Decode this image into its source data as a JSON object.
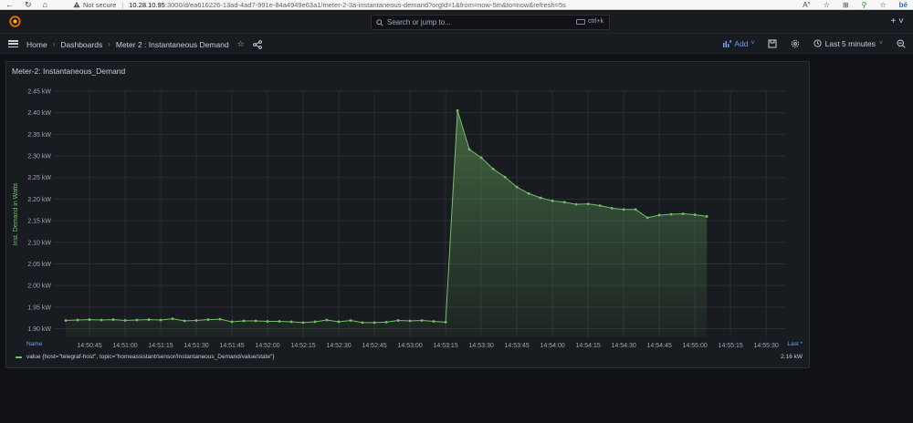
{
  "browser": {
    "nav_glyphs": [
      "←",
      "↻",
      "⌂"
    ],
    "security_label": "Not secure",
    "url_host": "10.28.10.95",
    "url_rest": ":3000/d/ea616226-13ad-4ad7-991e-84a4949e63a1/meter-2-3a-instantaneous-demand?orgId=1&from=now-5m&to=now&refresh=5s",
    "right_glyphs": [
      "A°",
      "☆",
      "⊞",
      "⚲",
      "☆",
      "bé"
    ]
  },
  "topnav": {
    "search_placeholder": "Search or jump to...",
    "shortcut": "ctrl+k",
    "plus": "+ ˅"
  },
  "breadcrumb": {
    "home": "Home",
    "dashboards": "Dashboards",
    "current": "Meter 2 : Instantaneous Demand"
  },
  "toolbar": {
    "add_label": "Add",
    "time_range": "Last 5 minutes"
  },
  "panel": {
    "title": "Meter-2: Instantaneous_Demand",
    "legend_name_header": "Name",
    "legend_last_header": "Last *",
    "series_label": "value {host=\"telegraf-host\", topic=\"homeassistant/sensor/Instantaneous_Demand/value/state\"}",
    "series_last": "2.16 kW"
  },
  "colors": {
    "series": "#73bf69",
    "accent": "#6e9fff",
    "background": "#111217",
    "panel": "#181b1f"
  },
  "chart_data": {
    "type": "area",
    "title": "Meter-2: Instantaneous_Demand",
    "xlabel": "",
    "ylabel": "Inst. Demand in Watts",
    "ylim": [
      1.88,
      2.45
    ],
    "y_ticks": [
      "1.90 kW",
      "1.95 kW",
      "2.00 kW",
      "2.05 kW",
      "2.10 kW",
      "2.15 kW",
      "2.20 kW",
      "2.25 kW",
      "2.30 kW",
      "2.35 kW",
      "2.40 kW",
      "2.45 kW"
    ],
    "y_tick_values": [
      1.9,
      1.95,
      2.0,
      2.05,
      2.1,
      2.15,
      2.2,
      2.25,
      2.3,
      2.35,
      2.4,
      2.45
    ],
    "x_ticks": [
      "14:50:45",
      "14:51:00",
      "14:51:15",
      "14:51:30",
      "14:51:45",
      "14:52:00",
      "14:52:15",
      "14:52:30",
      "14:52:45",
      "14:53:00",
      "14:53:15",
      "14:53:30",
      "14:53:45",
      "14:54:00",
      "14:54:15",
      "14:54:30",
      "14:54:45",
      "14:55:00",
      "14:55:15",
      "14:55:30"
    ],
    "x_tick_seconds": [
      45,
      60,
      75,
      90,
      105,
      120,
      135,
      150,
      165,
      180,
      195,
      210,
      225,
      240,
      255,
      270,
      285,
      300,
      315,
      330
    ],
    "x_seconds_after": "14:50:00",
    "grid": true,
    "legend": "bottom",
    "series": [
      {
        "values": [
          [
            35,
            1.919
          ],
          [
            40,
            1.92
          ],
          [
            45,
            1.921
          ],
          [
            50,
            1.92
          ],
          [
            55,
            1.921
          ],
          [
            60,
            1.919
          ],
          [
            65,
            1.92
          ],
          [
            70,
            1.921
          ],
          [
            75,
            1.92
          ],
          [
            80,
            1.923
          ],
          [
            85,
            1.918
          ],
          [
            90,
            1.919
          ],
          [
            95,
            1.921
          ],
          [
            100,
            1.922
          ],
          [
            105,
            1.916
          ],
          [
            110,
            1.918
          ],
          [
            115,
            1.918
          ],
          [
            120,
            1.917
          ],
          [
            125,
            1.917
          ],
          [
            130,
            1.916
          ],
          [
            135,
            1.914
          ],
          [
            140,
            1.916
          ],
          [
            145,
            1.92
          ],
          [
            150,
            1.916
          ],
          [
            155,
            1.919
          ],
          [
            160,
            1.914
          ],
          [
            165,
            1.914
          ],
          [
            170,
            1.915
          ],
          [
            175,
            1.919
          ],
          [
            180,
            1.918
          ],
          [
            185,
            1.919
          ],
          [
            190,
            1.917
          ],
          [
            195,
            1.915
          ],
          [
            200,
            2.405
          ],
          [
            205,
            2.315
          ],
          [
            210,
            2.296
          ],
          [
            215,
            2.27
          ],
          [
            220,
            2.251
          ],
          [
            225,
            2.228
          ],
          [
            230,
            2.213
          ],
          [
            235,
            2.203
          ],
          [
            240,
            2.196
          ],
          [
            245,
            2.193
          ],
          [
            250,
            2.188
          ],
          [
            255,
            2.189
          ],
          [
            260,
            2.185
          ],
          [
            265,
            2.179
          ],
          [
            270,
            2.176
          ],
          [
            275,
            2.176
          ],
          [
            280,
            2.157
          ],
          [
            285,
            2.163
          ],
          [
            290,
            2.165
          ],
          [
            295,
            2.166
          ],
          [
            300,
            2.164
          ],
          [
            305,
            2.16
          ]
        ]
      }
    ]
  }
}
